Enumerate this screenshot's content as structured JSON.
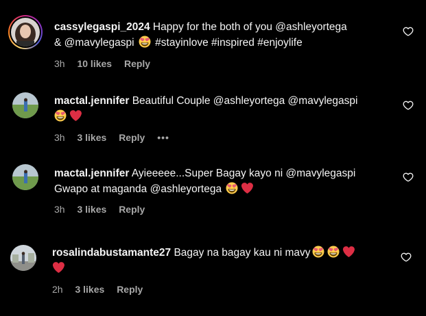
{
  "comments": [
    {
      "username": "cassylegaspi_2024",
      "line1": " Happy for the both of you @ashleyortega",
      "line2a": "& @mavylegaspi ",
      "line2b": " #stayinlove #inspired #enjoylife",
      "time": "3h",
      "likes": "10 likes",
      "reply": "Reply"
    },
    {
      "username": "mactal.jennifer",
      "line1": " Beautiful Couple @ashleyortega @mavylegaspi",
      "time": "3h",
      "likes": "3 likes",
      "reply": "Reply",
      "more": "•••"
    },
    {
      "username": "mactal.jennifer",
      "line1": " Ayieeeee...Super Bagay kayo ni @mavylegaspi",
      "line2a": "Gwapo at maganda @ashleyortega ",
      "time": "3h",
      "likes": "3 likes",
      "reply": "Reply"
    },
    {
      "username": "rosalindabustamante27",
      "line1": " Bagay na bagay kau ni mavy",
      "time": "2h",
      "likes": "3 likes",
      "reply": "Reply"
    }
  ],
  "colors": {
    "background": "#000000",
    "text": "#f5f5f5",
    "meta": "#a8a8a8",
    "heart": "#e0245e"
  },
  "icons": {
    "like": "heart-outline-icon",
    "heart_eyes": "heart-eyes-emoji",
    "red_heart": "red-heart-emoji",
    "more": "more-options-icon"
  }
}
